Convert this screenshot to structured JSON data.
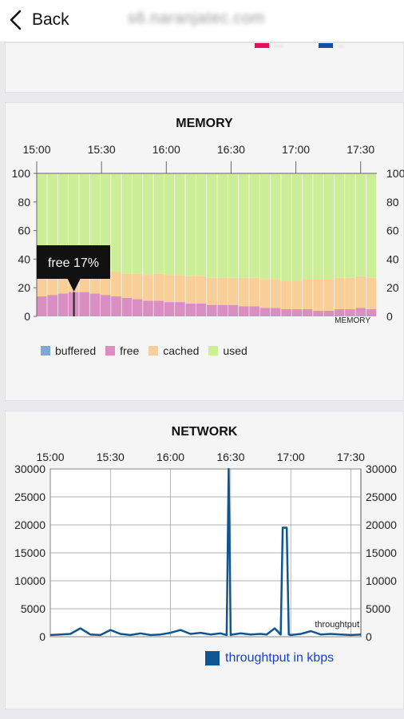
{
  "header": {
    "back_label": "Back",
    "url": "s6.naranjatec.com"
  },
  "top_card": {
    "legend": [
      {
        "label": "···",
        "color": "#e0105a"
      },
      {
        "label": "··",
        "color": "#1a4fa0"
      }
    ]
  },
  "memory": {
    "title": "MEMORY",
    "time_ticks": [
      "15:00",
      "15:30",
      "16:00",
      "16:30",
      "17:00",
      "17:30"
    ],
    "y_ticks": [
      "100",
      "80",
      "60",
      "40",
      "20",
      "0"
    ],
    "inner_label": "MEMORY",
    "tooltip": "free 17%",
    "legend": [
      {
        "label": "buffered",
        "color": "#7fa9d4"
      },
      {
        "label": "free",
        "color": "#d98fc2"
      },
      {
        "label": "cached",
        "color": "#f8cf99"
      },
      {
        "label": "used",
        "color": "#cdee99"
      }
    ]
  },
  "network": {
    "title": "NETWORK",
    "time_ticks": [
      "15:00",
      "15:30",
      "16:00",
      "16:30",
      "17:00",
      "17:30"
    ],
    "y_ticks": [
      "30000",
      "25000",
      "20000",
      "15000",
      "10000",
      "5000",
      "0"
    ],
    "inner_label": "throughtput",
    "legend_label": "throughtput in kbps",
    "legend_color": "#0e5692"
  },
  "chart_data": [
    {
      "type": "bar",
      "title": "MEMORY",
      "x": [
        "15:00",
        "15:05",
        "15:10",
        "15:15",
        "15:20",
        "15:25",
        "15:30",
        "15:35",
        "15:40",
        "15:45",
        "15:50",
        "15:55",
        "16:00",
        "16:05",
        "16:10",
        "16:15",
        "16:20",
        "16:25",
        "16:30",
        "16:35",
        "16:40",
        "16:45",
        "16:50",
        "16:55",
        "17:00",
        "17:05",
        "17:10",
        "17:15",
        "17:20",
        "17:25",
        "17:30",
        "17:35"
      ],
      "ylim": [
        0,
        100
      ],
      "series": [
        {
          "name": "buffered",
          "values": [
            0,
            0,
            0,
            0,
            0,
            0,
            0,
            0,
            0,
            0,
            0,
            0,
            0,
            0,
            0,
            0,
            0,
            0,
            0,
            0,
            0,
            0,
            0,
            0,
            0,
            0,
            0,
            0,
            0,
            0,
            0,
            0
          ]
        },
        {
          "name": "free",
          "values": [
            14,
            15,
            16,
            17,
            17,
            16,
            15,
            14,
            13,
            12,
            11,
            11,
            10,
            10,
            9,
            9,
            8,
            8,
            8,
            7,
            7,
            6,
            6,
            5,
            5,
            5,
            4,
            4,
            5,
            5,
            6,
            5
          ]
        },
        {
          "name": "cached",
          "values": [
            12,
            12,
            12,
            17,
            18,
            18,
            17,
            17,
            17,
            18,
            18,
            19,
            19,
            19,
            19,
            19,
            19,
            19,
            19,
            20,
            20,
            20,
            20,
            20,
            20,
            21,
            22,
            22,
            22,
            22,
            22,
            22
          ]
        },
        {
          "name": "used",
          "values": [
            74,
            73,
            72,
            66,
            65,
            66,
            68,
            69,
            70,
            70,
            71,
            70,
            71,
            71,
            72,
            72,
            73,
            73,
            73,
            73,
            73,
            74,
            74,
            75,
            75,
            74,
            74,
            74,
            73,
            73,
            72,
            73
          ]
        }
      ]
    },
    {
      "type": "line",
      "title": "NETWORK",
      "x": [
        "15:00",
        "15:05",
        "15:10",
        "15:15",
        "15:20",
        "15:25",
        "15:30",
        "15:35",
        "15:40",
        "15:45",
        "15:50",
        "15:55",
        "16:00",
        "16:05",
        "16:10",
        "16:15",
        "16:20",
        "16:25",
        "16:28",
        "16:29",
        "16:30",
        "16:31",
        "16:35",
        "16:40",
        "16:45",
        "16:48",
        "16:52",
        "16:55",
        "16:56",
        "16:58",
        "16:59",
        "17:00",
        "17:05",
        "17:10",
        "17:15",
        "17:20",
        "17:25",
        "17:30",
        "17:35"
      ],
      "ylim": [
        0,
        30000
      ],
      "series": [
        {
          "name": "throughtput",
          "values": [
            300,
            400,
            500,
            1500,
            400,
            300,
            1200,
            500,
            300,
            600,
            300,
            400,
            700,
            1200,
            500,
            700,
            400,
            600,
            300,
            30000,
            300,
            400,
            600,
            400,
            500,
            400,
            1500,
            400,
            19500,
            19500,
            400,
            300,
            500,
            1000,
            400,
            500,
            400,
            300,
            400
          ]
        }
      ]
    }
  ]
}
